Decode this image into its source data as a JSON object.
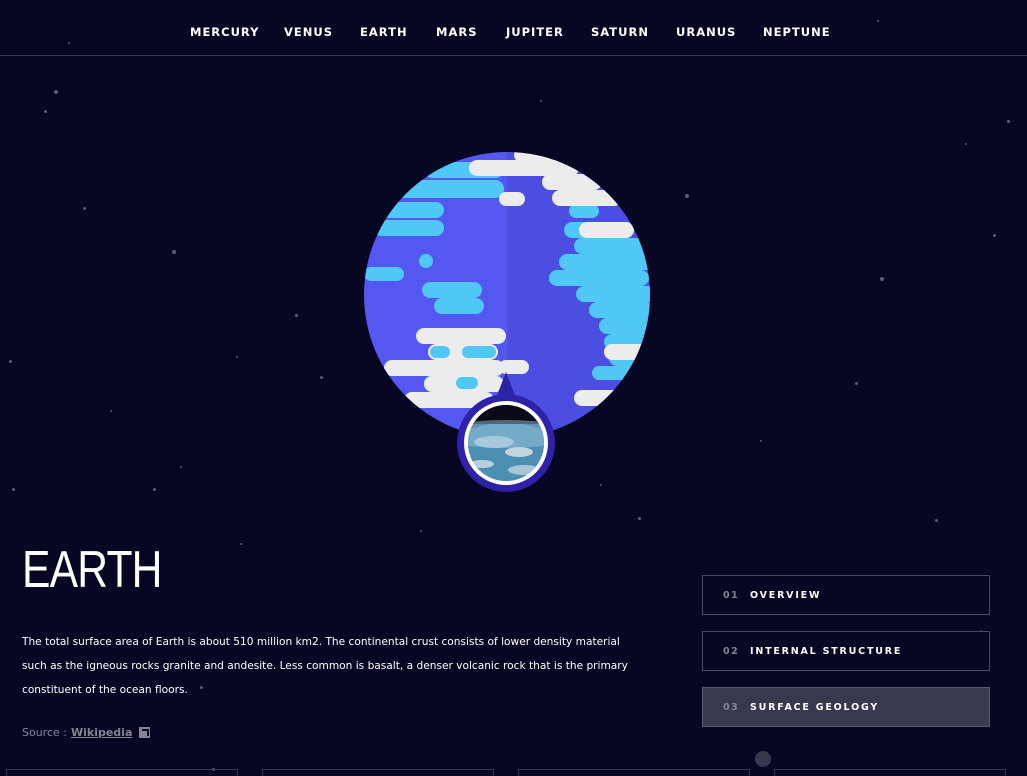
{
  "nav": {
    "items": [
      "MERCURY",
      "VENUS",
      "EARTH",
      "MARS",
      "JUPITER",
      "SATURN",
      "URANUS",
      "NEPTUNE"
    ]
  },
  "planet": {
    "name": "EARTH",
    "description": "The total surface area of Earth is about 510 million km2. The continental crust consists of lower density material such as the igneous rocks granite and andesite. Less common is basalt, a denser volcanic rock that is the primary constituent of the ocean floors.",
    "source_prefix": "Source : ",
    "source_link": "Wikipedia",
    "illustration_icon": "earth-illustration",
    "geology_thumbnail_icon": "earth-surface-photo"
  },
  "tabs": [
    {
      "num": "01",
      "label": "OVERVIEW"
    },
    {
      "num": "02",
      "label": "INTERNAL STRUCTURE"
    },
    {
      "num": "03",
      "label": "SURFACE GEOLOGY"
    }
  ],
  "active_tab": "03",
  "colors": {
    "background": "#070724",
    "active_tab": "#38384f",
    "ocean_light": "#4fc3f7",
    "ocean_dark": "#5457e8",
    "clouds": "#ffffff"
  }
}
